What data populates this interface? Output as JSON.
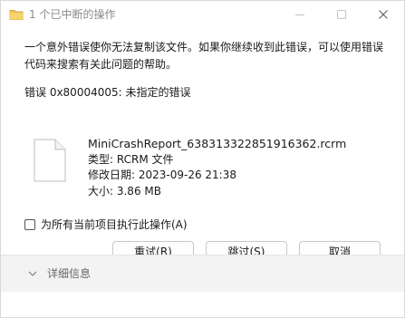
{
  "window": {
    "title": "1 个已中断的操作",
    "icon": "folder-copy-icon"
  },
  "message": {
    "body": "一个意外错误使你无法复制该文件。如果你继续收到此错误，可以使用错误代码来搜索有关此问题的帮助。",
    "error_code": "错误 0x80004005: 未指定的错误"
  },
  "file": {
    "icon": "document-icon",
    "name": "MiniCrashReport_638313322851916362.rcrm",
    "type": "类型: RCRM 文件",
    "modified": "修改日期: 2023-09-26 21:38",
    "size": "大小: 3.86 MB"
  },
  "apply_all": {
    "label": "为所有当前项目执行此操作(A)",
    "checked": false
  },
  "buttons": {
    "retry": "重试(R)",
    "skip": "跳过(S)",
    "cancel": "取消"
  },
  "footer": {
    "details": "详细信息"
  },
  "colors": {
    "background": "#ffffff",
    "footer_bg": "#f3f3f3",
    "text": "#1a1a1a",
    "muted": "#8a8a8a"
  }
}
